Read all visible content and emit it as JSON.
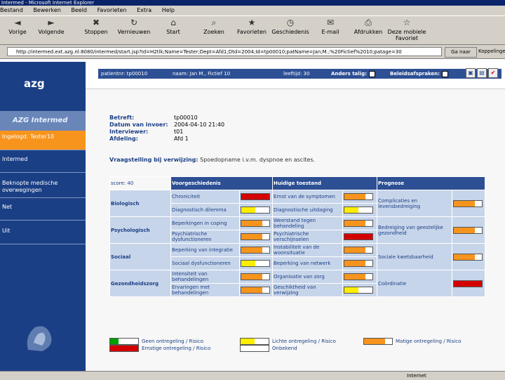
{
  "window": {
    "title": "Intermed - Microsoft Internet Explorer"
  },
  "menu": [
    "Bestand",
    "Bewerken",
    "Beeld",
    "Favorieten",
    "Extra",
    "Help"
  ],
  "toolbar": [
    {
      "label": "Vorige",
      "icon": "back-arrow-icon",
      "glyph": "◄"
    },
    {
      "label": "Volgende",
      "icon": "forward-arrow-icon",
      "glyph": "►"
    },
    {
      "label": "Stoppen",
      "icon": "stop-icon",
      "glyph": "✖"
    },
    {
      "label": "Vernieuwen",
      "icon": "refresh-icon",
      "glyph": "↻"
    },
    {
      "label": "Start",
      "icon": "home-icon",
      "glyph": "⌂"
    },
    {
      "label": "Zoeken",
      "icon": "search-icon",
      "glyph": "⌕"
    },
    {
      "label": "Favorieten",
      "icon": "favorites-icon",
      "glyph": "★"
    },
    {
      "label": "Geschiedenis",
      "icon": "history-icon",
      "glyph": "◷"
    },
    {
      "label": "E-mail",
      "icon": "mail-icon",
      "glyph": "✉"
    },
    {
      "label": "Afdrukken",
      "icon": "print-icon",
      "glyph": "⎙"
    },
    {
      "label": "Deze mobiele Favoriet",
      "icon": "mobile-favorite-icon",
      "glyph": "☆"
    }
  ],
  "address": {
    "url": "http://intermed.ext.azg.nl:8080/intermed/start.jsp?Id=H2tlk;Name=Tester;Dept=Afd1;Dtd=2004;Id=tp00010;patName=Jan;M.;%20Fictief%2010;patage=30",
    "go": "Ga naar",
    "links": "Koppelingen"
  },
  "sidebar": {
    "logo": "azg",
    "brand": "AZG Intermed",
    "items": [
      {
        "label": "Ingelogd: Tester10",
        "active": true
      },
      {
        "label": "Intermed",
        "active": false
      },
      {
        "label": "Beknopte medische overwegingen",
        "active": false
      },
      {
        "label": "Net",
        "active": false
      },
      {
        "label": "Uit",
        "active": false
      }
    ]
  },
  "header": {
    "patient": "patientnr: tp00010",
    "name": "naam: Jan M., Fictief 10",
    "age": "leeftijd: 30",
    "anders": "Anders talig:",
    "beleid": "Beleidsafspraken:"
  },
  "info": [
    {
      "label": "Betreft:",
      "value": "tp00010"
    },
    {
      "label": "Datum van invoer:",
      "value": "2004-04-10 21:40"
    },
    {
      "label": "Interviewer:",
      "value": "t01"
    },
    {
      "label": "Afdeling:",
      "value": "Afd 1"
    }
  ],
  "verwijzing": {
    "label": "Vraagstelling bij verwijzing:",
    "value": "Spoedopname i.v.m. dyspnoe en ascites."
  },
  "score": "score: 40",
  "columns": {
    "history": "Voorgeschiedenis",
    "current": "Huidige toestand",
    "prognosis": "Prognose"
  },
  "colors": {
    "green": "#00a000",
    "yellow": "#ffee00",
    "orange": "#f7941d",
    "red": "#d40000"
  },
  "rows": [
    {
      "category": "Biologisch",
      "sub": [
        {
          "h_label": "Chroniciteit",
          "h_level": "red",
          "c_label": "Ernst van de symptomen",
          "c_level": "orange"
        },
        {
          "h_label": "Diagnostisch dilemma",
          "h_level": "yellow",
          "c_label": "Diagnostische uitdaging",
          "c_level": "yellow"
        }
      ],
      "p_label": "Complicaties en levensbedreiging",
      "p_level": "orange"
    },
    {
      "category": "Psychologisch",
      "sub": [
        {
          "h_label": "Beperkingen in coping",
          "h_level": "orange",
          "c_label": "Weerstand tegen behandeling",
          "c_level": "orange"
        },
        {
          "h_label": "Psychiatrische dysfunctioneren",
          "h_level": "orange",
          "c_label": "Psychiatrische verschijnselen",
          "c_level": "red"
        }
      ],
      "p_label": "Bedreiging van geestelijke gezondheid",
      "p_level": "orange"
    },
    {
      "category": "Sociaal",
      "sub": [
        {
          "h_label": "Beperking van integratie",
          "h_level": "orange",
          "c_label": "Instabiliteit van de woonsituatie",
          "c_level": "orange"
        },
        {
          "h_label": "Sociaal dysfunctioneren",
          "h_level": "yellow",
          "c_label": "Beperking van netwerk",
          "c_level": "orange"
        }
      ],
      "p_label": "Sociale kwetsbaarheid",
      "p_level": "orange"
    },
    {
      "category": "Gezondheidszorg",
      "sub": [
        {
          "h_label": "Intensiteit van behandelingen",
          "h_level": "orange",
          "c_label": "Organisatie van zorg",
          "c_level": "orange"
        },
        {
          "h_label": "Ervaringen met behandelingen",
          "h_level": "orange",
          "c_label": "Geschiktheid van verwijzing",
          "c_level": "yellow"
        }
      ],
      "p_label": "Coördinatie",
      "p_level": "red"
    }
  ],
  "levels": {
    "green": 0.3,
    "yellow": 0.5,
    "orange": 0.75,
    "red": 1.0
  },
  "legend": [
    {
      "label": "Geen ontregeling / Risico",
      "level": "green"
    },
    {
      "label": "Lichte ontregeling / Risico",
      "level": "yellow"
    },
    {
      "label": "Matige ontregeling / Risico",
      "level": "orange"
    },
    {
      "label": "Ernstige ontregeling / Risico",
      "level": "red"
    },
    {
      "label": "Onbekend",
      "level": "none"
    }
  ],
  "status": {
    "left": "",
    "right": "Internet"
  }
}
